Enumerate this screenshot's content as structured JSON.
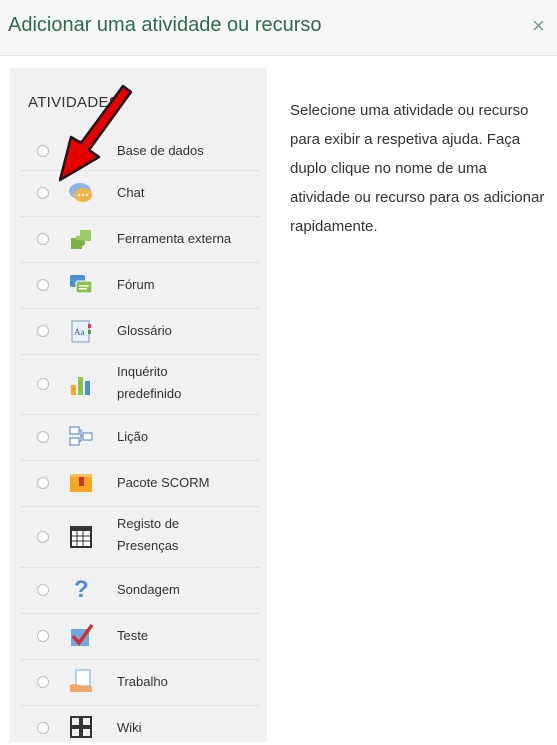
{
  "dialog": {
    "title": "Adicionar uma atividade ou recurso",
    "close": "×"
  },
  "section": {
    "heading": "ATIVIDADES"
  },
  "help_text": "Selecione uma atividade ou recurso para exibir a respetiva ajuda. Faça duplo clique no nome de uma atividade ou recurso para os adicionar rapidamente.",
  "items": [
    {
      "label": "Base de dados",
      "icon": "database-icon"
    },
    {
      "label": "Chat",
      "icon": "chat-icon"
    },
    {
      "label": "Ferramenta externa",
      "icon": "puzzle-icon"
    },
    {
      "label": "Fórum",
      "icon": "forum-icon"
    },
    {
      "label": "Glossário",
      "icon": "glossary-icon"
    },
    {
      "label": "Inquérito predefinido",
      "icon": "bar-chart-icon"
    },
    {
      "label": "Lição",
      "icon": "lesson-icon"
    },
    {
      "label": "Pacote SCORM",
      "icon": "package-icon"
    },
    {
      "label": "Registo de Presenças",
      "icon": "attendance-icon"
    },
    {
      "label": "Sondagem",
      "icon": "question-icon"
    },
    {
      "label": "Teste",
      "icon": "checkmark-icon"
    },
    {
      "label": "Trabalho",
      "icon": "assignment-icon"
    },
    {
      "label": "Wiki",
      "icon": "wiki-icon"
    }
  ],
  "colors": {
    "title": "#2c6b4f",
    "arrow": "#e60000"
  }
}
